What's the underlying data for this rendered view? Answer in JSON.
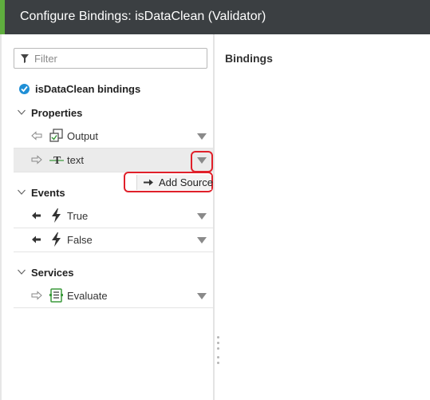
{
  "window": {
    "title": "Configure Bindings: isDataClean (Validator)"
  },
  "filter": {
    "placeholder": "Filter",
    "value": ""
  },
  "tree": {
    "root_label": "isDataClean bindings",
    "sections": [
      {
        "label": "Properties"
      },
      {
        "label": "Events"
      },
      {
        "label": "Services"
      }
    ],
    "properties": [
      {
        "label": "Output",
        "icon": "output-icon",
        "direction": "outgoing"
      },
      {
        "label": "text",
        "icon": "text-type-icon",
        "direction": "incoming"
      }
    ],
    "events": [
      {
        "label": "True",
        "icon": "lightning-icon"
      },
      {
        "label": "False",
        "icon": "lightning-icon"
      }
    ],
    "services": [
      {
        "label": "Evaluate",
        "icon": "service-icon"
      }
    ]
  },
  "popup": {
    "add_source_label": "Add Source"
  },
  "right_panel": {
    "title": "Bindings"
  },
  "colors": {
    "accent": "#5fae3e",
    "titlebar": "#3b3f42",
    "highlight": "#e0202a",
    "check": "#1f8fd6",
    "icon_green": "#3c9a3c"
  }
}
